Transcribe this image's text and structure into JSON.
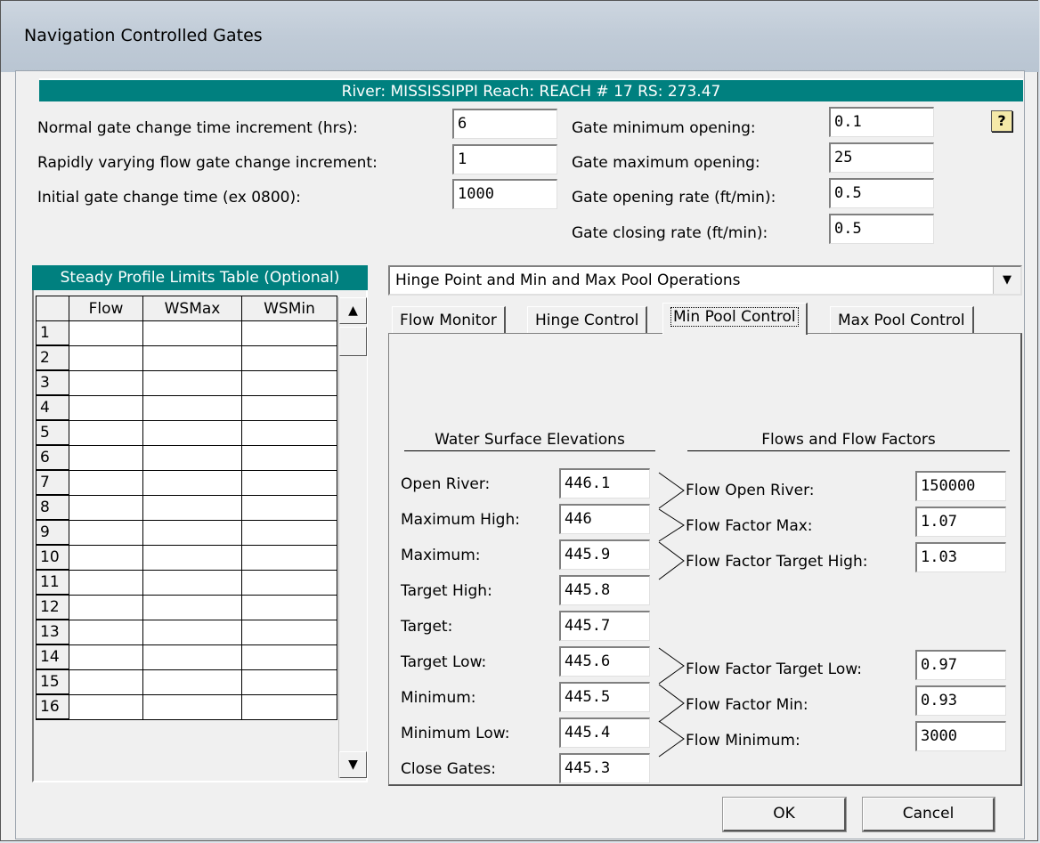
{
  "window": {
    "title": "Navigation Controlled Gates"
  },
  "river_bar": "River: MISSISSIPPI  Reach: REACH # 17  RS: 273.47",
  "settings": {
    "normal_gate_change_label": "Normal gate change time increment (hrs):",
    "normal_gate_change_value": "6",
    "rapid_flow_label": "Rapidly varying flow gate change increment:",
    "rapid_flow_value": "1",
    "initial_gate_label": "Initial gate change time (ex 0800):",
    "initial_gate_value": "1000",
    "gate_min_label": "Gate minimum opening:",
    "gate_min_value": "0.1",
    "gate_max_label": "Gate maximum opening:",
    "gate_max_value": "25",
    "gate_open_rate_label": "Gate opening rate (ft/min):",
    "gate_open_rate_value": "0.5",
    "gate_close_rate_label": "Gate closing rate (ft/min):",
    "gate_close_rate_value": "0.5"
  },
  "help_icon": "?",
  "limits_table": {
    "title": "Steady Profile Limits Table (Optional)",
    "columns": [
      "Flow",
      "WSMax",
      "WSMin"
    ],
    "row_numbers": [
      "1",
      "2",
      "3",
      "4",
      "5",
      "6",
      "7",
      "8",
      "9",
      "10",
      "11",
      "12",
      "13",
      "14",
      "15",
      "16"
    ]
  },
  "operation_select": {
    "value": "Hinge Point and Min and Max Pool Operations"
  },
  "tabs": [
    {
      "label": "Flow Monitor"
    },
    {
      "label": "Hinge Control"
    },
    {
      "label": "Min Pool Control"
    },
    {
      "label": "Max Pool Control"
    }
  ],
  "active_tab": "Min Pool Control",
  "min_pool": {
    "wse_header": "Water Surface Elevations",
    "flows_header": "Flows and Flow Factors",
    "wse": [
      {
        "label": "Open River:",
        "value": "446.1"
      },
      {
        "label": "Maximum High:",
        "value": "446"
      },
      {
        "label": "Maximum:",
        "value": "445.9"
      },
      {
        "label": "Target High:",
        "value": "445.8"
      },
      {
        "label": "Target:",
        "value": "445.7"
      },
      {
        "label": "Target Low:",
        "value": "445.6"
      },
      {
        "label": "Minimum:",
        "value": "445.5"
      },
      {
        "label": "Minimum Low:",
        "value": "445.4"
      },
      {
        "label": "Close Gates:",
        "value": "445.3"
      }
    ],
    "flows": [
      {
        "label": "Flow Open River:",
        "value": "150000"
      },
      {
        "label": "Flow Factor Max:",
        "value": "1.07"
      },
      {
        "label": "Flow Factor Target High:",
        "value": "1.03"
      },
      {
        "label": "Flow Factor Target Low:",
        "value": "0.97"
      },
      {
        "label": "Flow Factor Min:",
        "value": "0.93"
      },
      {
        "label": "Flow Minimum:",
        "value": "3000"
      }
    ]
  },
  "buttons": {
    "ok": "OK",
    "cancel": "Cancel"
  },
  "icons": {
    "help": "help-icon",
    "dropdown": "chevron-down-icon",
    "scroll_up": "arrow-up-icon",
    "scroll_down": "arrow-down-icon"
  }
}
